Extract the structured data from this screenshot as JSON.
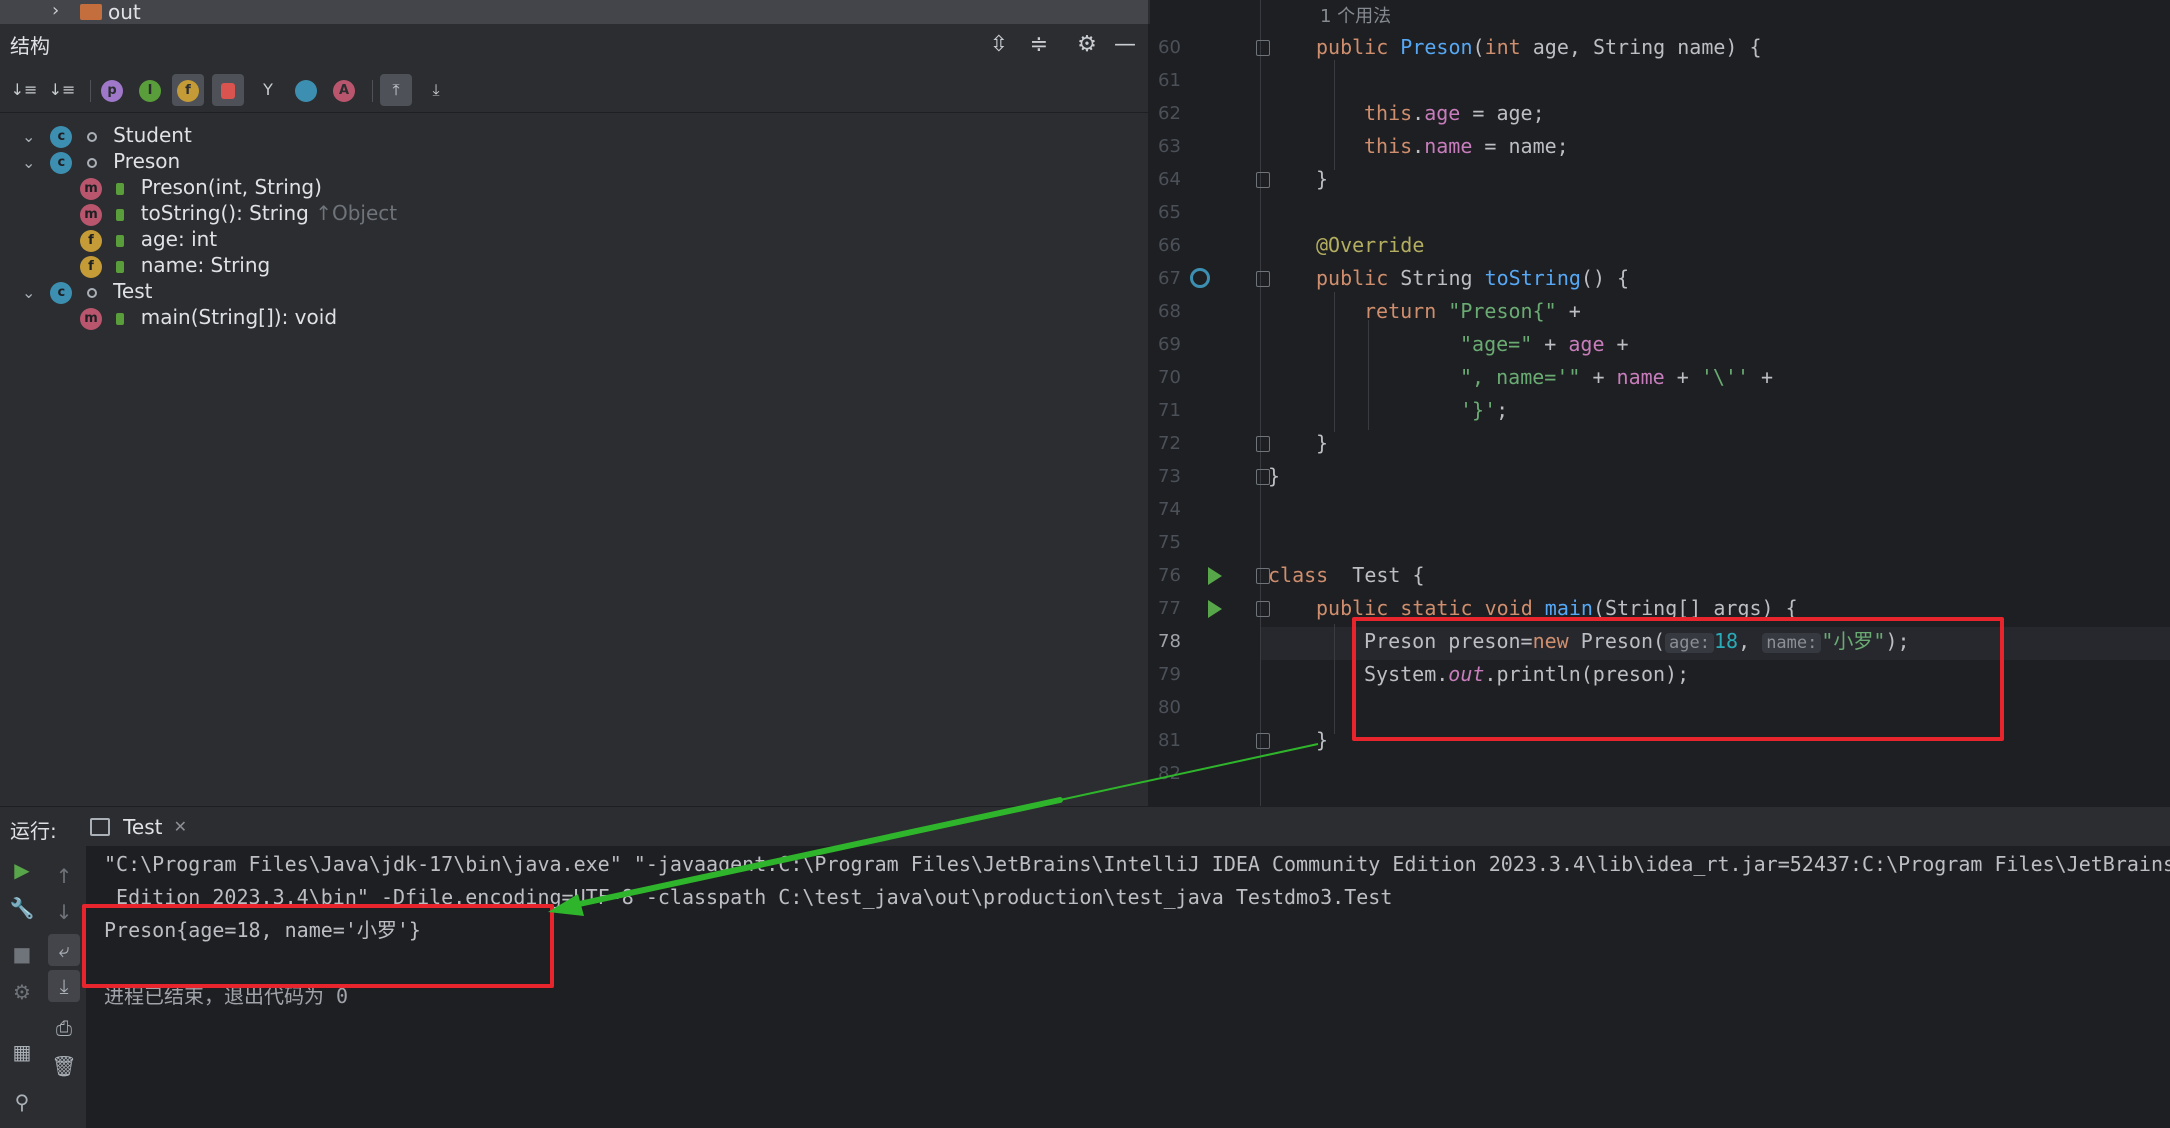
{
  "top_folder": {
    "label": "out"
  },
  "structure": {
    "title": "结构",
    "nodes": [
      {
        "label": "Student",
        "badge": "c"
      },
      {
        "label": "Preson",
        "badge": "c"
      },
      {
        "label": "Preson(int, String)",
        "badge": "m"
      },
      {
        "label": "toString(): String",
        "badge": "m",
        "hint": "↑Object"
      },
      {
        "label": "age: int",
        "badge": "f"
      },
      {
        "label": "name: String",
        "badge": "f"
      },
      {
        "label": "Test",
        "badge": "c"
      },
      {
        "label": "main(String[]): void",
        "badge": "m"
      }
    ]
  },
  "editor": {
    "usage_hint": "1 个用法",
    "line_numbers": [
      "60",
      "61",
      "62",
      "63",
      "64",
      "65",
      "66",
      "67",
      "68",
      "69",
      "70",
      "71",
      "72",
      "73",
      "74",
      "75",
      "76",
      "77",
      "78",
      "79",
      "80",
      "81",
      "82"
    ],
    "current_line": "78",
    "inlay_age": "age:",
    "inlay_name": "name:",
    "lines": {
      "l60": {
        "t1": "public ",
        "t2": "Preson",
        "t3": "(",
        "t4": "int",
        "t5": " age, String name) {"
      },
      "l62": {
        "t1": "this",
        "t2": ".",
        "t3": "age",
        "t4": " = age;"
      },
      "l63": {
        "t1": "this",
        "t2": ".",
        "t3": "name",
        "t4": " = name;"
      },
      "l64": "}",
      "l66": "@Override",
      "l67": {
        "t1": "public ",
        "t2": "String ",
        "t3": "toString",
        "t4": "() {"
      },
      "l68": {
        "t1": "return ",
        "t2": "\"Preson{\"",
        "t3": " +"
      },
      "l69": {
        "t1": "\"age=\"",
        "t2": " + ",
        "t3": "age",
        "t4": " +"
      },
      "l70": {
        "t1": "\", name='\"",
        "t2": " + ",
        "t3": "name",
        "t4": " + ",
        "t5": "'\\''",
        "t6": " +"
      },
      "l71": {
        "t1": "'}'",
        "t2": ";"
      },
      "l72": "}",
      "l73": "}",
      "l76": {
        "t1": "class ",
        "t2": " Test {"
      },
      "l77": {
        "t1": "public static void ",
        "t2": "main",
        "t3": "(String[] args) {"
      },
      "l78": {
        "t1": "Preson preson=",
        "t2": "new ",
        "t3": "Preson(",
        "t4": "18",
        "t5": ",",
        "t6": "\"小罗\"",
        "t7": ");"
      },
      "l79": {
        "t1": "System.",
        "t2": "out",
        "t3": ".println(preson);"
      },
      "l81": "}"
    }
  },
  "run": {
    "label": "运行:",
    "tab_label": "Test",
    "console": [
      "\"C:\\Program Files\\Java\\jdk-17\\bin\\java.exe\" \"-javaagent:C:\\Program Files\\JetBrains\\IntelliJ IDEA Community Edition 2023.3.4\\lib\\idea_rt.jar=52437:C:\\Program Files\\JetBrains",
      " Edition 2023.3.4\\bin\" -Dfile.encoding=UTF-8 -classpath C:\\test_java\\out\\production\\test_java Testdmo3.Test",
      "Preson{age=18, name='小罗'}",
      "",
      "进程已结束，退出代码为 0"
    ]
  },
  "colors": {
    "annotation_box": "#e8242d",
    "annotation_arrow": "#2fb52b"
  }
}
